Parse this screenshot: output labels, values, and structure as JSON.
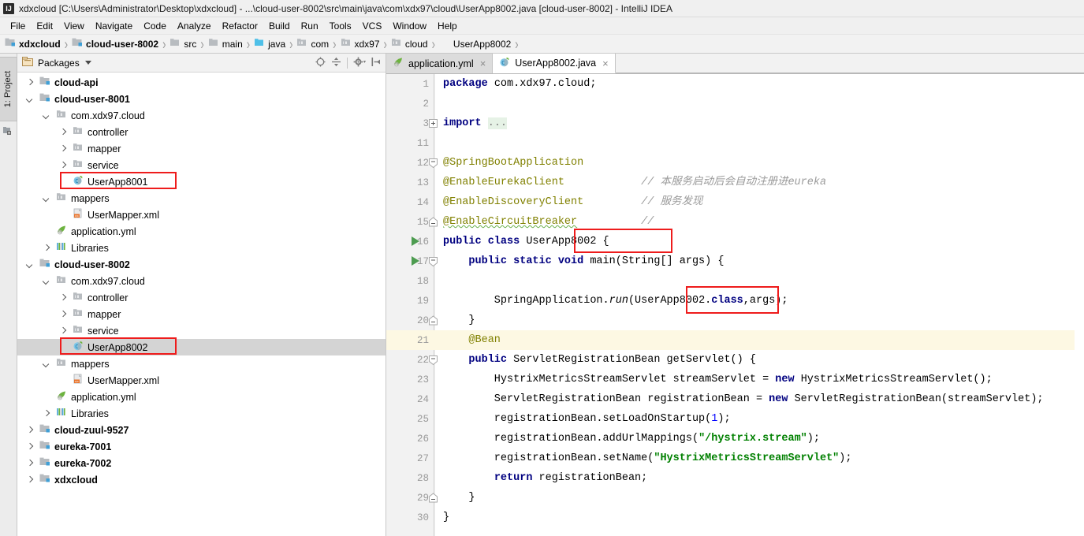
{
  "window": {
    "title": "xdxcloud [C:\\Users\\Administrator\\Desktop\\xdxcloud] - ...\\cloud-user-8002\\src\\main\\java\\com\\xdx97\\cloud\\UserApp8002.java [cloud-user-8002] - IntelliJ IDEA",
    "logo": "IJ"
  },
  "menubar": {
    "items": [
      {
        "label": "File"
      },
      {
        "label": "Edit"
      },
      {
        "label": "View"
      },
      {
        "label": "Navigate"
      },
      {
        "label": "Code"
      },
      {
        "label": "Analyze"
      },
      {
        "label": "Refactor"
      },
      {
        "label": "Build"
      },
      {
        "label": "Run"
      },
      {
        "label": "Tools"
      },
      {
        "label": "VCS"
      },
      {
        "label": "Window"
      },
      {
        "label": "Help"
      }
    ]
  },
  "breadcrumb": {
    "items": [
      {
        "label": "xdxcloud",
        "icon": "module-icon",
        "bold": true
      },
      {
        "label": "cloud-user-8002",
        "icon": "module-icon",
        "bold": true
      },
      {
        "label": "src",
        "icon": "folder-icon",
        "bold": false
      },
      {
        "label": "main",
        "icon": "folder-icon",
        "bold": false
      },
      {
        "label": "java",
        "icon": "source-folder-icon",
        "bold": false
      },
      {
        "label": "com",
        "icon": "package-icon",
        "bold": false
      },
      {
        "label": "xdx97",
        "icon": "package-icon",
        "bold": false
      },
      {
        "label": "cloud",
        "icon": "package-icon",
        "bold": false
      },
      {
        "label": "UserApp8002",
        "icon": "java-class-icon",
        "bold": false
      }
    ]
  },
  "toolstrip": {
    "project_tab": "1: Project",
    "structure_icon": "structure-icon"
  },
  "project_panel": {
    "title": "Packages",
    "actions": [
      {
        "name": "collapse-target-icon",
        "glyph": "target-icon"
      },
      {
        "name": "expand-collapse-icon",
        "glyph": "split-icon"
      },
      {
        "name": "settings-gear-icon",
        "glyph": "gear-icon"
      },
      {
        "name": "hide-panel-icon",
        "glyph": "hide-icon"
      }
    ],
    "tree": [
      {
        "label": "cloud-api",
        "depth": 0,
        "arrow": "right",
        "icon": "module-icon",
        "bold": true,
        "selected": false,
        "boxed": false
      },
      {
        "label": "cloud-user-8001",
        "depth": 0,
        "arrow": "down",
        "icon": "module-icon",
        "bold": true,
        "selected": false,
        "boxed": false
      },
      {
        "label": "com.xdx97.cloud",
        "depth": 1,
        "arrow": "down",
        "icon": "package-icon",
        "bold": false,
        "selected": false,
        "boxed": false
      },
      {
        "label": "controller",
        "depth": 2,
        "arrow": "right",
        "icon": "package-icon",
        "bold": false,
        "selected": false,
        "boxed": false
      },
      {
        "label": "mapper",
        "depth": 2,
        "arrow": "right",
        "icon": "package-icon",
        "bold": false,
        "selected": false,
        "boxed": false
      },
      {
        "label": "service",
        "depth": 2,
        "arrow": "right",
        "icon": "package-icon",
        "bold": false,
        "selected": false,
        "boxed": false
      },
      {
        "label": "UserApp8001",
        "depth": 2,
        "arrow": "none",
        "icon": "spring-class-icon",
        "bold": false,
        "selected": false,
        "boxed": true
      },
      {
        "label": "mappers",
        "depth": 1,
        "arrow": "down",
        "icon": "package-icon",
        "bold": false,
        "selected": false,
        "boxed": false
      },
      {
        "label": "UserMapper.xml",
        "depth": 2,
        "arrow": "none",
        "icon": "xml-icon",
        "bold": false,
        "selected": false,
        "boxed": false
      },
      {
        "label": "application.yml",
        "depth": 1,
        "arrow": "none",
        "icon": "spring-yml-icon",
        "bold": false,
        "selected": false,
        "boxed": false
      },
      {
        "label": "Libraries",
        "depth": 1,
        "arrow": "right",
        "icon": "library-icon",
        "bold": false,
        "selected": false,
        "boxed": false
      },
      {
        "label": "cloud-user-8002",
        "depth": 0,
        "arrow": "down",
        "icon": "module-icon",
        "bold": true,
        "selected": false,
        "boxed": false
      },
      {
        "label": "com.xdx97.cloud",
        "depth": 1,
        "arrow": "down",
        "icon": "package-icon",
        "bold": false,
        "selected": false,
        "boxed": false
      },
      {
        "label": "controller",
        "depth": 2,
        "arrow": "right",
        "icon": "package-icon",
        "bold": false,
        "selected": false,
        "boxed": false
      },
      {
        "label": "mapper",
        "depth": 2,
        "arrow": "right",
        "icon": "package-icon",
        "bold": false,
        "selected": false,
        "boxed": false
      },
      {
        "label": "service",
        "depth": 2,
        "arrow": "right",
        "icon": "package-icon",
        "bold": false,
        "selected": false,
        "boxed": false
      },
      {
        "label": "UserApp8002",
        "depth": 2,
        "arrow": "none",
        "icon": "spring-class-icon",
        "bold": false,
        "selected": true,
        "boxed": true
      },
      {
        "label": "mappers",
        "depth": 1,
        "arrow": "down",
        "icon": "package-icon",
        "bold": false,
        "selected": false,
        "boxed": false
      },
      {
        "label": "UserMapper.xml",
        "depth": 2,
        "arrow": "none",
        "icon": "xml-icon",
        "bold": false,
        "selected": false,
        "boxed": false
      },
      {
        "label": "application.yml",
        "depth": 1,
        "arrow": "none",
        "icon": "spring-yml-icon",
        "bold": false,
        "selected": false,
        "boxed": false
      },
      {
        "label": "Libraries",
        "depth": 1,
        "arrow": "right",
        "icon": "library-icon",
        "bold": false,
        "selected": false,
        "boxed": false
      },
      {
        "label": "cloud-zuul-9527",
        "depth": 0,
        "arrow": "right",
        "icon": "module-icon",
        "bold": true,
        "selected": false,
        "boxed": false
      },
      {
        "label": "eureka-7001",
        "depth": 0,
        "arrow": "right",
        "icon": "module-icon",
        "bold": true,
        "selected": false,
        "boxed": false
      },
      {
        "label": "eureka-7002",
        "depth": 0,
        "arrow": "right",
        "icon": "module-icon",
        "bold": true,
        "selected": false,
        "boxed": false
      },
      {
        "label": "xdxcloud",
        "depth": 0,
        "arrow": "right",
        "icon": "module-icon",
        "bold": true,
        "selected": false,
        "boxed": false
      }
    ]
  },
  "editor": {
    "tabs": [
      {
        "label": "application.yml",
        "icon": "spring-yml-icon",
        "active": false,
        "close": "×"
      },
      {
        "label": "UserApp8002.java",
        "icon": "spring-class-icon",
        "active": true,
        "close": "×"
      }
    ],
    "highlight_line": 21,
    "gutter_numbers": [
      "1",
      "2",
      "3",
      "11",
      "12",
      "13",
      "14",
      "15",
      "16",
      "17",
      "18",
      "19",
      "20",
      "21",
      "22",
      "23",
      "24",
      "25",
      "26",
      "27",
      "28",
      "29",
      "30"
    ],
    "run_arrow_lines": [
      "16",
      "17"
    ],
    "fold_markers": [
      {
        "line": "3",
        "type": "plus"
      },
      {
        "line": "12",
        "type": "minus-top"
      },
      {
        "line": "15",
        "type": "minus-bottom"
      },
      {
        "line": "17",
        "type": "minus-top"
      },
      {
        "line": "20",
        "type": "minus-bottom"
      },
      {
        "line": "22",
        "type": "minus-top"
      },
      {
        "line": "29",
        "type": "minus-bottom"
      }
    ],
    "code_lines": [
      "package com.xdx97.cloud;",
      "",
      "import ...",
      "",
      "@SpringBootApplication",
      "@EnableEurekaClient            // 本服务启动后会自动注册进eureka",
      "@EnableDiscoveryClient         // 服务发现",
      "@EnableCircuitBreaker          //",
      "public class UserApp8002 {",
      "    public static void main(String[] args) {",
      "",
      "        SpringApplication.run(UserApp8002.class,args);",
      "    }",
      "    @Bean",
      "    public ServletRegistrationBean getServlet() {",
      "        HystrixMetricsStreamServlet streamServlet = new HystrixMetricsStreamServlet();",
      "        ServletRegistrationBean registrationBean = new ServletRegistrationBean(streamServlet);",
      "        registrationBean.setLoadOnStartup(1);",
      "        registrationBean.addUrlMappings(\"/hystrix.stream\");",
      "        registrationBean.setName(\"HystrixMetricsStreamServlet\");",
      "        return registrationBean;",
      "    }",
      "}"
    ],
    "comments": {
      "eureka_register": "// 本服务启动后会自动注册进eureka",
      "service_discovery": "// 服务发现",
      "empty": "//"
    },
    "annotations": {
      "spring_boot_application": "@SpringBootApplication",
      "enable_eureka_client": "@EnableEurekaClient",
      "enable_discovery_client": "@EnableDiscoveryClient",
      "enable_circuit_breaker": "@EnableCircuitBreaker",
      "bean": "@Bean"
    },
    "strings": {
      "hystrix_stream": "\"/hystrix.stream\"",
      "hystrix_servlet_name": "\"HystrixMetricsStreamServlet\""
    },
    "highlight_boxes": [
      {
        "name": "class-name-box",
        "target": "UserApp8002 {"
      },
      {
        "name": "class-ref-box",
        "target": "UserApp8002.class"
      }
    ]
  },
  "colors": {
    "accent_red": "#ee1c1c",
    "keyword_blue": "#000080",
    "annotation_olive": "#808000",
    "string_green": "#008000",
    "comment_gray": "#9a9a9a",
    "selection_gray": "#d4d4d4",
    "caret_row_yellow": "#fdf8e3",
    "run_green": "#4d9c50"
  }
}
